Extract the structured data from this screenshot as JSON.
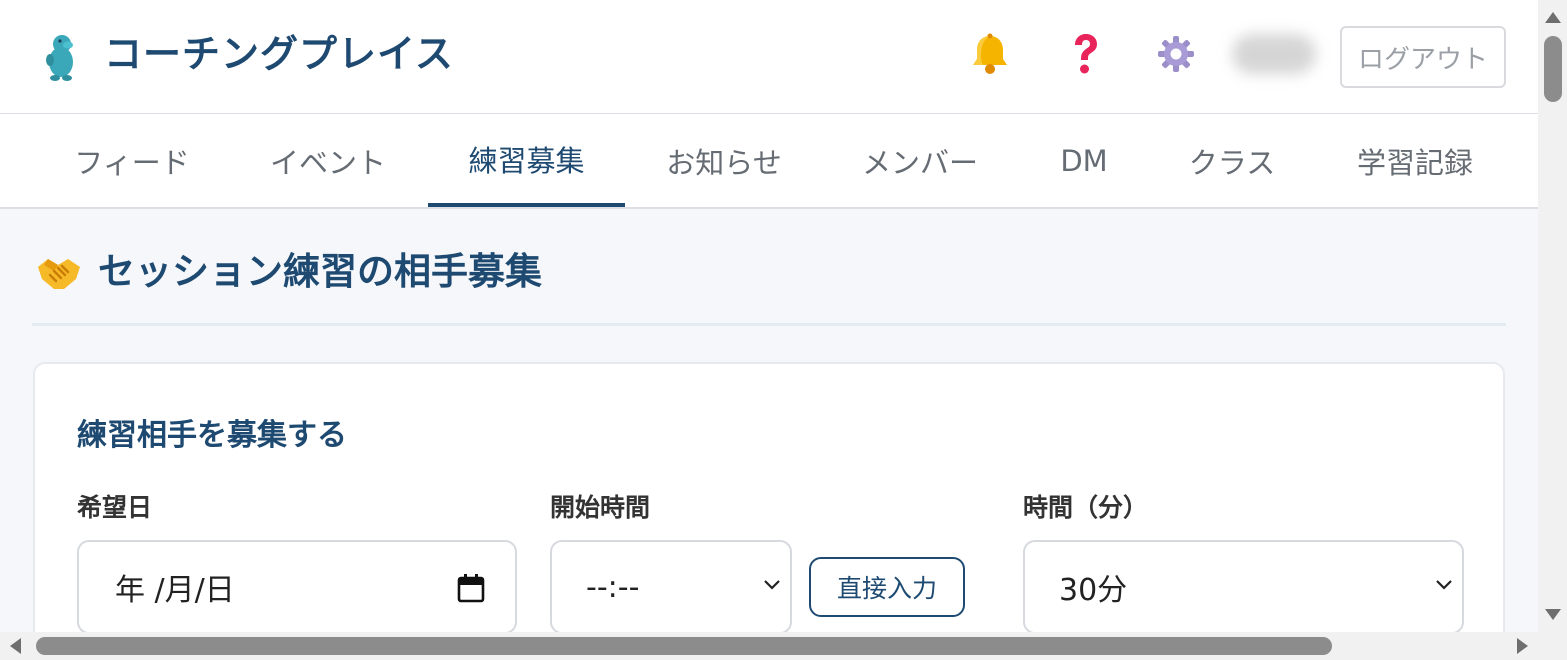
{
  "app": {
    "title": "コーチングプレイス"
  },
  "header": {
    "icons": [
      "bell-icon",
      "help-icon",
      "gear-icon"
    ],
    "logout_label": "ログアウト"
  },
  "nav": {
    "tabs": [
      {
        "label": "フィード",
        "active": false
      },
      {
        "label": "イベント",
        "active": false
      },
      {
        "label": "練習募集",
        "active": true
      },
      {
        "label": "お知らせ",
        "active": false
      },
      {
        "label": "メンバー",
        "active": false
      },
      {
        "label": "DM",
        "active": false
      },
      {
        "label": "クラス",
        "active": false
      },
      {
        "label": "学習記録",
        "active": false
      }
    ]
  },
  "page": {
    "icon": "handshake-icon",
    "title": "セッション練習の相手募集"
  },
  "form": {
    "title": "練習相手を募集する",
    "date": {
      "label": "希望日",
      "value": "年 /月/日"
    },
    "start_time": {
      "label": "開始時間",
      "value": "--:--"
    },
    "direct_input_label": "直接入力",
    "duration": {
      "label": "時間（分）",
      "value": "30分"
    }
  },
  "colors": {
    "brand": "#1e4a72",
    "background": "#f5f7fa",
    "accent_active_tab": "#1e4a72"
  }
}
